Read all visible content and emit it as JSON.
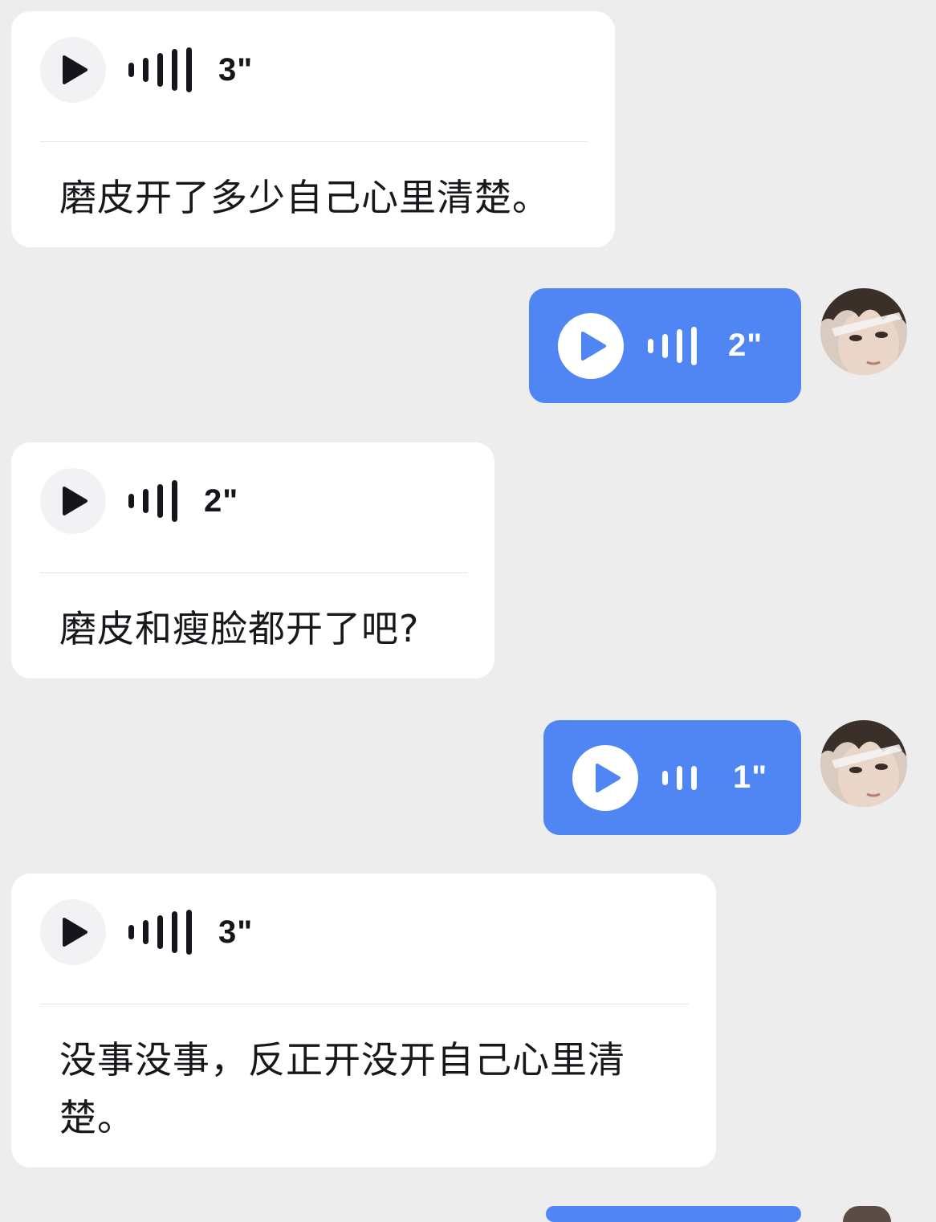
{
  "messages": [
    {
      "direction": "in",
      "duration": "3\"",
      "transcript": "磨皮开了多少自己心里清楚。"
    },
    {
      "direction": "out",
      "duration": "2\""
    },
    {
      "direction": "in",
      "duration": "2\"",
      "transcript": "磨皮和瘦脸都开了吧?"
    },
    {
      "direction": "out",
      "duration": "1\""
    },
    {
      "direction": "in",
      "duration": "3\"",
      "transcript": "没事没事，反正开没开自己心里清楚。"
    }
  ],
  "icons": {
    "play": "play-icon",
    "waveform": "voice-waveform-icon",
    "avatar": "user-avatar"
  },
  "colors": {
    "background": "#ededed",
    "incoming_bubble": "#ffffff",
    "outgoing_bubble": "#4f86f4",
    "text": "#18181c"
  }
}
